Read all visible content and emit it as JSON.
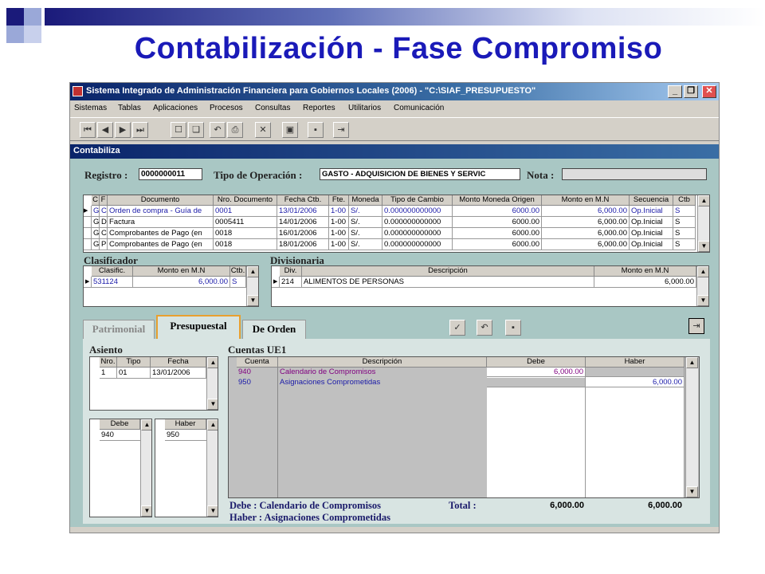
{
  "slide": {
    "title": "Contabilización - Fase Compromiso"
  },
  "window": {
    "title": "Sistema Integrado de Administración Financiera para Gobiernos Locales (2006) - \"C:\\SIAF_PRESUPUESTO\""
  },
  "menu": [
    "Sistemas",
    "Tablas",
    "Aplicaciones",
    "Procesos",
    "Consultas",
    "Reportes",
    "Utilitarios",
    "Comunicación"
  ],
  "form": {
    "title": "Contabiliza",
    "registro_label": "Registro :",
    "registro_value": "0000000011",
    "tipo_label": "Tipo de Operación :",
    "tipo_value": "GASTO - ADQUISICION DE BIENES Y SERVIC",
    "nota_label": "Nota :",
    "nota_value": ""
  },
  "docs": {
    "headers": [
      "C",
      "F",
      "Documento",
      "Nro. Documento",
      "Fecha Ctb.",
      "Fte.",
      "Moneda",
      "Tipo de Cambio",
      "Monto Moneda Origen",
      "Monto en M.N",
      "Secuencia",
      "Ctb"
    ],
    "rows": [
      {
        "c": "G",
        "f": "C",
        "doc": "Orden de compra - Guía de",
        "nro": "0001",
        "fecha": "13/01/2006",
        "fte": "1-00",
        "mon": "S/.",
        "tc": "0.000000000000",
        "mo": "6000.00",
        "mn": "6,000.00",
        "sec": "Op.Inicial",
        "ctb": "S"
      },
      {
        "c": "G",
        "f": "D",
        "doc": "Factura",
        "nro": "0005411",
        "fecha": "14/01/2006",
        "fte": "1-00",
        "mon": "S/.",
        "tc": "0.000000000000",
        "mo": "6000.00",
        "mn": "6,000.00",
        "sec": "Op.Inicial",
        "ctb": "S"
      },
      {
        "c": "G",
        "f": "C",
        "doc": "Comprobantes de Pago (en",
        "nro": "0018",
        "fecha": "16/01/2006",
        "fte": "1-00",
        "mon": "S/.",
        "tc": "0.000000000000",
        "mo": "6000.00",
        "mn": "6,000.00",
        "sec": "Op.Inicial",
        "ctb": "S"
      },
      {
        "c": "G",
        "f": "P",
        "doc": "Comprobantes de Pago (en",
        "nro": "0018",
        "fecha": "18/01/2006",
        "fte": "1-00",
        "mon": "S/.",
        "tc": "0.000000000000",
        "mo": "6000.00",
        "mn": "6,000.00",
        "sec": "Op.Inicial",
        "ctb": "S"
      }
    ]
  },
  "clasificador": {
    "label": "Clasificador",
    "headers": [
      "Clasific.",
      "Monto en M.N",
      "Ctb."
    ],
    "row": {
      "clas": "531124",
      "monto": "6,000.00",
      "ctb": "S"
    }
  },
  "divisionaria": {
    "label": "Divisionaria",
    "headers": [
      "Div.",
      "Descripción",
      "Monto en M.N"
    ],
    "row": {
      "div": "214",
      "desc": "ALIMENTOS DE PERSONAS",
      "monto": "6,000.00"
    }
  },
  "tabs": [
    "Patrimonial",
    "Presupuestal",
    "De Orden"
  ],
  "asiento": {
    "label": "Asiento",
    "headers": [
      "Nro.",
      "Tipo",
      "Fecha"
    ],
    "row": {
      "nro": "1",
      "tipo": "01",
      "fecha": "13/01/2006"
    }
  },
  "debe_list": {
    "header": "Debe",
    "value": "940"
  },
  "haber_list": {
    "header": "Haber",
    "value": "950"
  },
  "cuentas": {
    "label": "Cuentas UE1",
    "headers": [
      "Cuenta",
      "Descripción",
      "Debe",
      "Haber"
    ],
    "rows": [
      {
        "cuenta": "940",
        "desc": "Calendario de Compromisos",
        "debe": "6,000.00",
        "haber": ""
      },
      {
        "cuenta": "950",
        "desc": "Asignaciones Comprometidas",
        "debe": "",
        "haber": "6,000.00"
      }
    ]
  },
  "footer": {
    "debe_text": "Debe : Calendario de Compromisos",
    "haber_text": "Haber : Asignaciones Comprometidas",
    "total_label": "Total :",
    "total_debe": "6,000.00",
    "total_haber": "6,000.00"
  },
  "colors": {
    "title": "#1a1ab8",
    "form_bg": "#a9c7c4",
    "titlebar": "#0a246a"
  }
}
